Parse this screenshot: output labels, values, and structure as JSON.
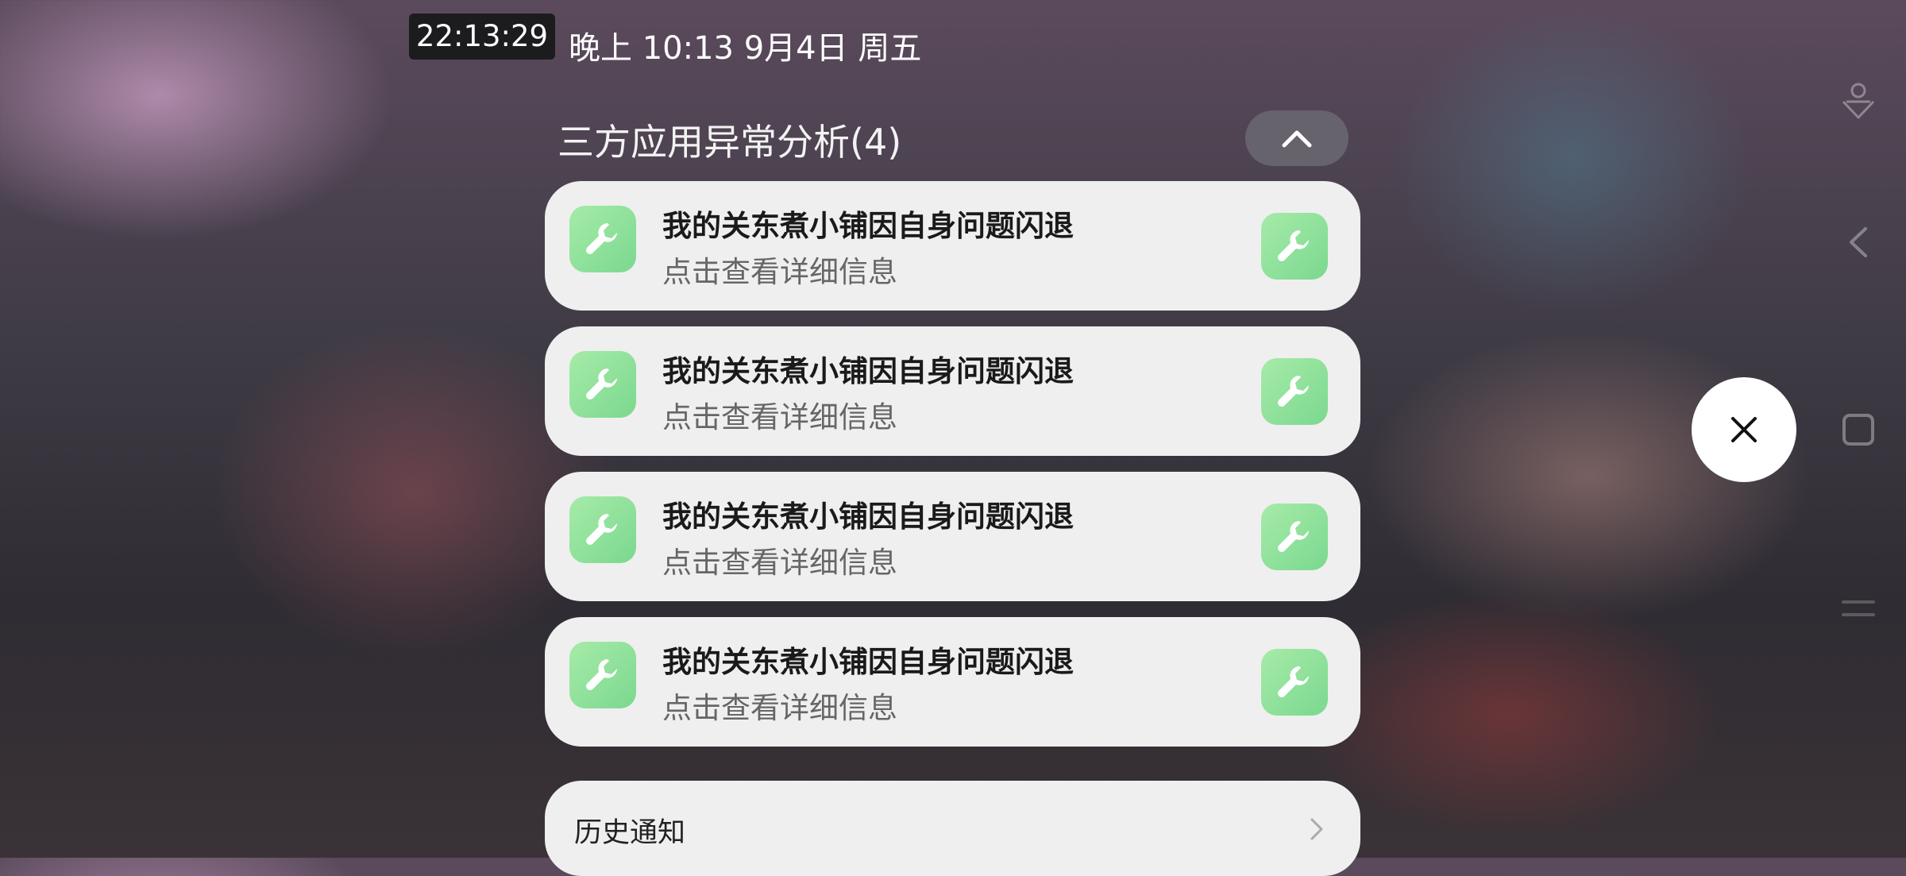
{
  "status": {
    "clock": "22:13:29",
    "datetime": "晚上 10:13  9月4日 周五"
  },
  "group": {
    "title": "三方应用异常分析(4)"
  },
  "notifications": [
    {
      "title": "我的关东煮小铺因自身问题闪退",
      "subtitle": "点击查看详细信息"
    },
    {
      "title": "我的关东煮小铺因自身问题闪退",
      "subtitle": "点击查看详细信息"
    },
    {
      "title": "我的关东煮小铺因自身问题闪退",
      "subtitle": "点击查看详细信息"
    },
    {
      "title": "我的关东煮小铺因自身问题闪退",
      "subtitle": "点击查看详细信息"
    }
  ],
  "history": {
    "label": "历史通知"
  },
  "icons": {
    "app": "wrench-icon",
    "collapse": "chevron-up-icon",
    "close": "close-icon",
    "history": "chevron-right-icon",
    "nav": [
      "assistant-icon",
      "back-icon",
      "recents-icon",
      "menu-icon"
    ]
  },
  "colors": {
    "card_bg": "#efefef",
    "icon_green": "#8ee09a",
    "title_text": "#1a1a1a",
    "subtitle_text": "#666666"
  }
}
